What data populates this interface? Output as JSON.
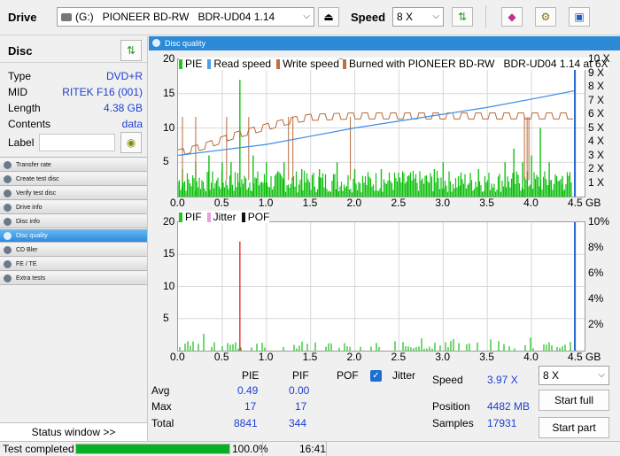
{
  "toolbar": {
    "drive_label": "Drive",
    "drive_letter": "(G:)",
    "drive_name": "PIONEER BD-RW   BDR-UD04 1.14",
    "speed_label": "Speed",
    "speed_value": "8 X"
  },
  "disc": {
    "header": "Disc",
    "rows": [
      {
        "key": "Type",
        "value": "DVD+R"
      },
      {
        "key": "MID",
        "value": "RITEK F16 (001)"
      },
      {
        "key": "Length",
        "value": "4.38 GB"
      },
      {
        "key": "Contents",
        "value": "data"
      },
      {
        "key": "Label",
        "value": ""
      }
    ]
  },
  "nav": {
    "items": [
      {
        "label": "Transfer rate",
        "active": false
      },
      {
        "label": "Create test disc",
        "active": false
      },
      {
        "label": "Verify test disc",
        "active": false
      },
      {
        "label": "Drive info",
        "active": false
      },
      {
        "label": "Disc info",
        "active": false
      },
      {
        "label": "Disc quality",
        "active": true
      },
      {
        "label": "CD Bler",
        "active": false
      },
      {
        "label": "FE / TE",
        "active": false
      },
      {
        "label": "Extra tests",
        "active": false
      }
    ],
    "status_window": "Status window >>"
  },
  "panel_title": "Disc quality",
  "chart_data": [
    {
      "type": "bar",
      "legend": [
        "PIE",
        "Read speed",
        "Write speed",
        "Burned with PIONEER BD-RW   BDR-UD04 1.14 at 6X"
      ],
      "x_ticks": [
        "0.0",
        "0.5",
        "1.0",
        "1.5",
        "2.0",
        "2.5",
        "3.0",
        "3.5",
        "4.0",
        "4.5 GB"
      ],
      "y_left_ticks": [
        "20",
        "15",
        "10",
        "5"
      ],
      "y_right_ticks": [
        "10 X",
        "9 X",
        "8 X",
        "7 X",
        "6 X",
        "5 X",
        "4 X",
        "3 X",
        "2 X",
        "1 X"
      ],
      "xlim": [
        0,
        4.5
      ],
      "ylim": [
        0,
        20
      ],
      "y2lim": [
        0,
        10
      ],
      "pie_peaks": [
        [
          0.05,
          4
        ],
        [
          0.2,
          5
        ],
        [
          0.35,
          6
        ],
        [
          0.5,
          5
        ],
        [
          0.6,
          5
        ],
        [
          0.7,
          17
        ],
        [
          0.85,
          6
        ],
        [
          1.0,
          5
        ],
        [
          1.2,
          5
        ],
        [
          1.4,
          4
        ],
        [
          1.6,
          4
        ],
        [
          1.8,
          5
        ],
        [
          2.0,
          4
        ],
        [
          2.3,
          4
        ],
        [
          2.6,
          3
        ],
        [
          2.9,
          4
        ],
        [
          3.0,
          5
        ],
        [
          3.2,
          3
        ],
        [
          3.4,
          4
        ],
        [
          3.7,
          5
        ],
        [
          3.8,
          7
        ],
        [
          3.9,
          5
        ],
        [
          4.0,
          6
        ],
        [
          4.1,
          10
        ],
        [
          4.2,
          5
        ],
        [
          4.35,
          3
        ]
      ],
      "read_speed": {
        "x": [
          0,
          0.5,
          1.0,
          1.5,
          2.0,
          2.5,
          3.0,
          3.5,
          4.0,
          4.48
        ],
        "y": [
          3.0,
          3.4,
          3.8,
          4.4,
          5.0,
          5.5,
          6.0,
          6.5,
          7.1,
          7.7
        ]
      },
      "write_speed": {
        "x": [
          0,
          0.3,
          0.6,
          1.0,
          1.3,
          1.5,
          2.0,
          3.0,
          4.0,
          4.48
        ],
        "y": [
          3.4,
          3.9,
          4.6,
          5.3,
          5.8,
          6.0,
          6.1,
          6.1,
          6.1,
          6.1
        ]
      },
      "write_dips": [
        0.05,
        0.2,
        0.55,
        0.8,
        1.25,
        1.3,
        1.95,
        3.92,
        3.95,
        3.97
      ]
    },
    {
      "type": "bar",
      "legend": [
        "PIF",
        "Jitter",
        "POF"
      ],
      "x_ticks": [
        "0.0",
        "0.5",
        "1.0",
        "1.5",
        "2.0",
        "2.5",
        "3.0",
        "3.5",
        "4.0",
        "4.5 GB"
      ],
      "y_left_ticks": [
        "20",
        "15",
        "10",
        "5"
      ],
      "y_right_ticks": [
        "10%",
        "8%",
        "6%",
        "4%",
        "2%"
      ],
      "xlim": [
        0,
        4.5
      ],
      "ylim": [
        0,
        20
      ],
      "pif_peak": {
        "x": 0.7,
        "y": 17
      }
    }
  ],
  "stats": {
    "col_pie": "PIE",
    "col_pif": "PIF",
    "col_pof": "POF",
    "jitter_label": "Jitter",
    "jitter_checked": true,
    "rows": [
      {
        "label": "Avg",
        "pie": "0.49",
        "pif": "0.00"
      },
      {
        "label": "Max",
        "pie": "17",
        "pif": "17"
      },
      {
        "label": "Total",
        "pie": "8841",
        "pif": "344"
      }
    ],
    "speed_label": "Speed",
    "speed_value": "3.97 X",
    "position_label": "Position",
    "position_value": "4482 MB",
    "samples_label": "Samples",
    "samples_value": "17931",
    "speed_select": "8 X",
    "start_full": "Start full",
    "start_part": "Start part"
  },
  "status": {
    "text": "Test completed",
    "progress": 1.0,
    "percent": "100.0%",
    "time": "16:41"
  }
}
